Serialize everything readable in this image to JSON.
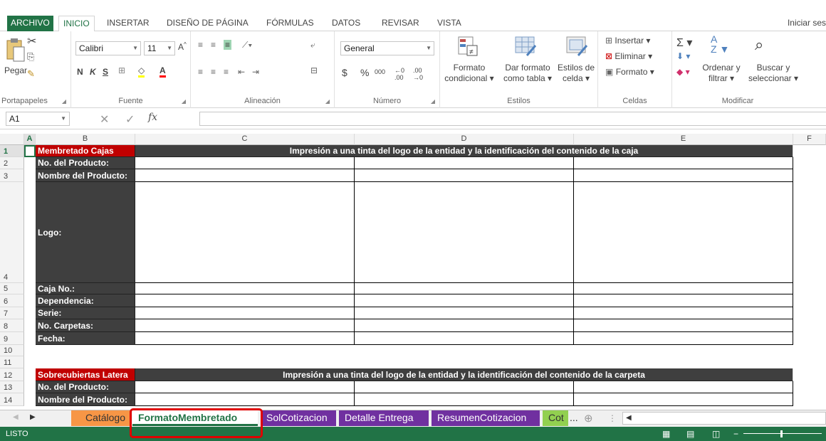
{
  "ribbon_tabs": [
    "ARCHIVO",
    "INICIO",
    "INSERTAR",
    "DISEÑO DE PÁGINA",
    "FÓRMULAS",
    "DATOS",
    "REVISAR",
    "VISTA"
  ],
  "sign_in": "Iniciar ses",
  "clipboard": {
    "paste": "Pegar",
    "label": "Portapapeles"
  },
  "font": {
    "name": "Calibri",
    "size": "11",
    "bold": "N",
    "italic": "K",
    "underline": "S",
    "label": "Fuente"
  },
  "alignment": {
    "label": "Alineación"
  },
  "number": {
    "format": "General",
    "currency": "$",
    "percent": "%",
    "thousands": "000",
    "label": "Número"
  },
  "styles": {
    "conditional": [
      "Formato",
      "condicional"
    ],
    "table": [
      "Dar formato",
      "como tabla"
    ],
    "cell": [
      "Estilos de",
      "celda"
    ],
    "label": "Estilos"
  },
  "cells_group": {
    "insert": "Insertar",
    "delete": "Eliminar",
    "format": "Formato",
    "label": "Celdas"
  },
  "modify": {
    "sort": [
      "Ordenar y",
      "filtrar"
    ],
    "find": [
      "Buscar y",
      "seleccionar"
    ],
    "label": "Modificar"
  },
  "formula_bar": {
    "name_box": "A1",
    "fx": "fx",
    "value": ""
  },
  "columns": [
    "A",
    "B",
    "C",
    "D",
    "E",
    "F"
  ],
  "rows": [
    "1",
    "2",
    "3",
    "4",
    "5",
    "6",
    "7",
    "8",
    "9",
    "10",
    "11",
    "12",
    "13",
    "14"
  ],
  "sheet": {
    "section1_title": "Membretado Cajas",
    "section1_header": "Impresión a una tinta del logo de la entidad y la identificación del contenido de la caja",
    "section1_fields": [
      "No. del Producto:",
      "Nombre del Producto:",
      "Logo:",
      "Caja No.:",
      "Dependencia:",
      "Serie:",
      "No. Carpetas:",
      "Fecha:"
    ],
    "section2_title": "Sobrecubiertas Latera",
    "section2_header": "Impresión a una tinta del logo de la entidad y la identificación del contenido de la carpeta",
    "section2_fields": [
      "No. del Producto:",
      "Nombre del Producto:"
    ]
  },
  "sheet_tabs": [
    {
      "label": "Catálogo",
      "color": "#f79646"
    },
    {
      "label": "FormatoMembretado",
      "color": "#ffffff"
    },
    {
      "label": "SolCotizacion",
      "color": "#7030a0"
    },
    {
      "label": "Detalle Entrega",
      "color": "#7030a0"
    },
    {
      "label": "ResumenCotizacion",
      "color": "#7030a0"
    },
    {
      "label": "Cot",
      "color": "#92d050"
    }
  ],
  "more_tabs": "...",
  "status": "LISTO",
  "colors": {
    "accent": "#217346",
    "label_dark": "#3f3f3f",
    "label_red": "#c00000",
    "highlight": "#e00000"
  }
}
